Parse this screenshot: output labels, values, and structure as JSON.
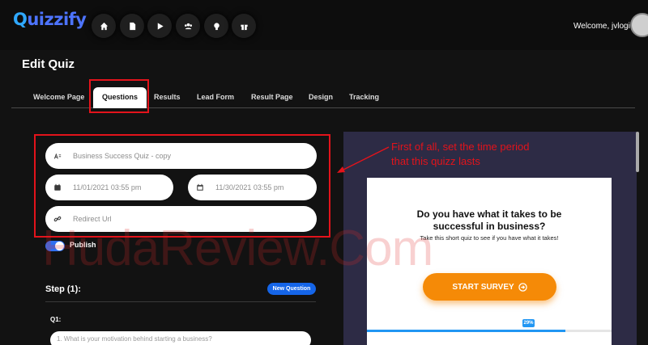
{
  "app": {
    "logo": "Quizzify",
    "logo_initial": "Q",
    "logo_rest": "uizzify"
  },
  "nav": [
    {
      "icon": "home-icon"
    },
    {
      "icon": "document-icon"
    },
    {
      "icon": "play-icon"
    },
    {
      "icon": "users-icon"
    },
    {
      "icon": "lightbulb-icon"
    },
    {
      "icon": "gift-icon"
    }
  ],
  "header": {
    "welcome": "Welcome, jvlogin"
  },
  "page": {
    "title": "Edit Quiz"
  },
  "tabs": [
    {
      "label": "Welcome Page",
      "active": false
    },
    {
      "label": "Questions",
      "active": true
    },
    {
      "label": "Results",
      "active": false
    },
    {
      "label": "Lead Form",
      "active": false
    },
    {
      "label": "Result Page",
      "active": false
    },
    {
      "label": "Design",
      "active": false
    },
    {
      "label": "Tracking",
      "active": false
    }
  ],
  "form": {
    "quiz_name": "Business Success Quiz - copy",
    "start_date": "11/01/2021 03:55 pm",
    "end_date": "11/30/2021 03:55 pm",
    "redirect_placeholder": "Redirect Url",
    "publish_label": "Publish",
    "publish_on": true
  },
  "steps": {
    "step_label": "Step (1):",
    "new_question": "New Question",
    "q_label": "Q1:",
    "q_value": "1. What is your motivation behind starting a business?"
  },
  "annotation": {
    "line1": "First of all, set the time period",
    "line2": "that this quizz lasts"
  },
  "preview": {
    "headline_1": "Do you have what it takes to be",
    "headline_2": "successful in business?",
    "subtext": "Take this short quiz to see if you have what it takes!",
    "start_button": "START SURVEY",
    "progress_label": "29%",
    "progress": 0.29
  },
  "watermark": "HudaReview.Com",
  "colors": {
    "highlight": "#e3131b",
    "accent": "#1565e8",
    "start": "#f58a07",
    "preview_bg": "#2d2b45"
  }
}
